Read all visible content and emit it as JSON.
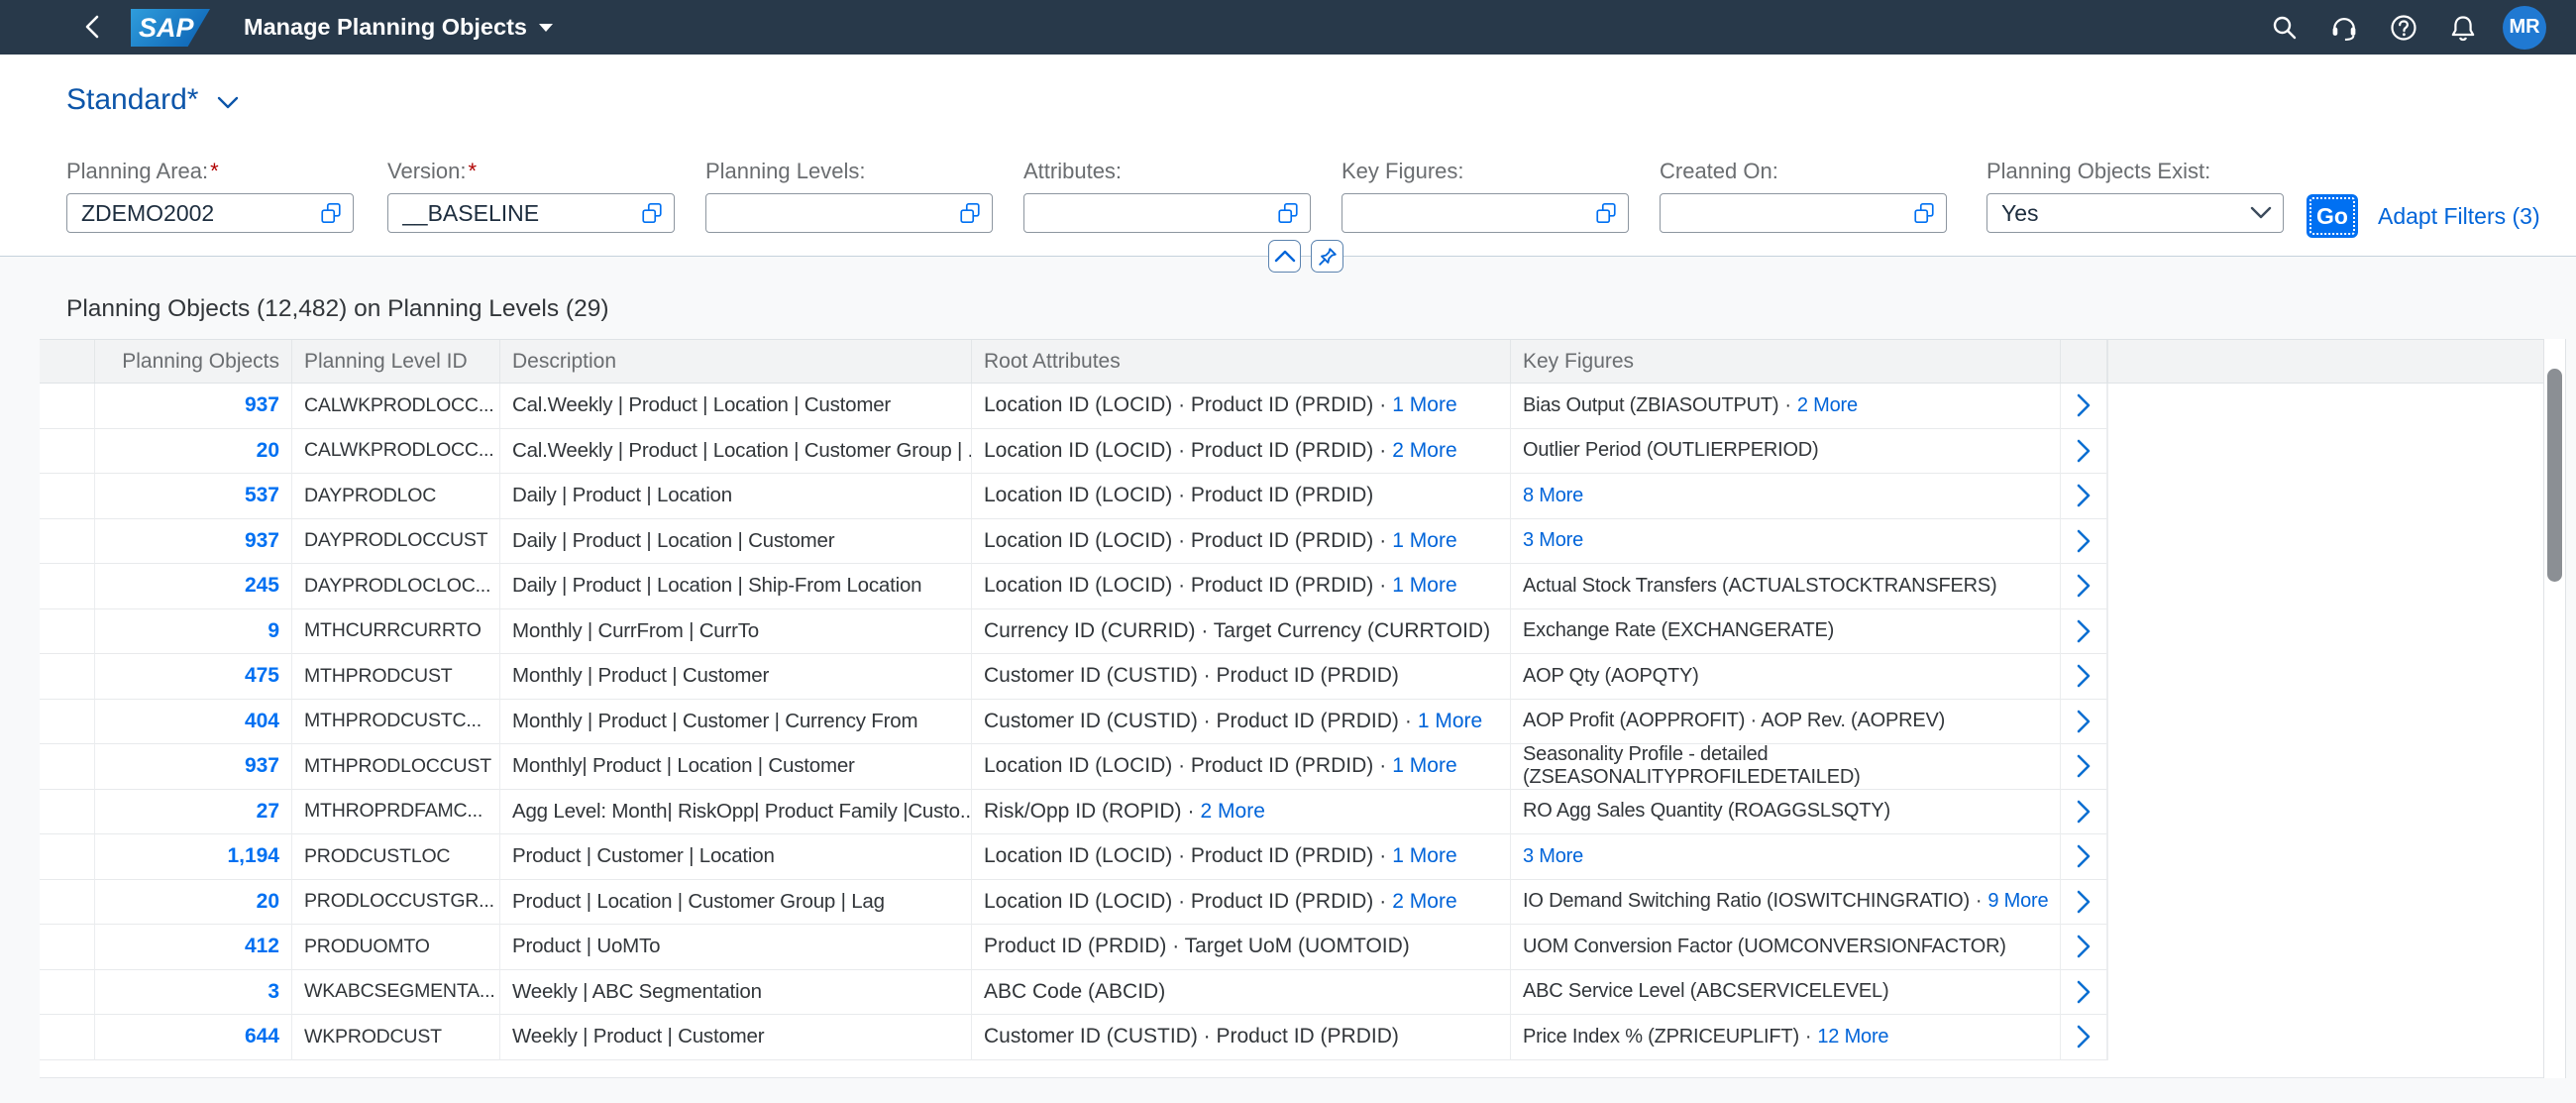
{
  "shell": {
    "title": "Manage Planning Objects",
    "logo": "SAP",
    "avatar_initials": "MR"
  },
  "variant": {
    "name": "Standard*"
  },
  "filters": {
    "fields": [
      {
        "label": "Planning Area:",
        "required": true,
        "value": "ZDEMO2002"
      },
      {
        "label": "Version:",
        "required": true,
        "value": "__BASELINE"
      },
      {
        "label": "Planning Levels:",
        "required": false,
        "value": ""
      },
      {
        "label": "Attributes:",
        "required": false,
        "value": ""
      },
      {
        "label": "Key Figures:",
        "required": false,
        "value": ""
      },
      {
        "label": "Created On:",
        "required": false,
        "value": ""
      }
    ],
    "exists": {
      "label": "Planning Objects Exist:",
      "value": "Yes"
    },
    "go_label": "Go",
    "adapt_filters_label": "Adapt Filters (3)"
  },
  "table": {
    "title": "Planning Objects (12,482) on Planning Levels (29)",
    "columns": [
      "Planning Objects",
      "Planning Level ID",
      "Description",
      "Root Attributes",
      "Key Figures"
    ],
    "rows": [
      {
        "objects": "937",
        "level_id": "CALWKPRODLOCC...",
        "description": "Cal.Weekly | Product | Location | Customer",
        "root": {
          "text": "Location ID (LOCID) · Product ID (PRDID)",
          "more": "1 More"
        },
        "kf": {
          "text": "Bias Output (ZBIASOUTPUT)",
          "more": "2 More"
        }
      },
      {
        "objects": "20",
        "level_id": "CALWKPRODLOCC...",
        "description": "Cal.Weekly | Product | Location | Customer Group | ...",
        "root": {
          "text": "Location ID (LOCID) · Product ID (PRDID)",
          "more": "2 More"
        },
        "kf": {
          "text": "Outlier Period (OUTLIERPERIOD)",
          "more": ""
        }
      },
      {
        "objects": "537",
        "level_id": "DAYPRODLOC",
        "description": "Daily | Product | Location",
        "root": {
          "text": "Location ID (LOCID) · Product ID (PRDID)",
          "more": ""
        },
        "kf": {
          "text": "",
          "more": "8 More"
        }
      },
      {
        "objects": "937",
        "level_id": "DAYPRODLOCCUST",
        "description": "Daily | Product | Location | Customer",
        "root": {
          "text": "Location ID (LOCID) · Product ID (PRDID)",
          "more": "1 More"
        },
        "kf": {
          "text": "",
          "more": "3 More"
        }
      },
      {
        "objects": "245",
        "level_id": "DAYPRODLOCLOC...",
        "description": "Daily | Product | Location | Ship-From Location",
        "root": {
          "text": "Location ID (LOCID) · Product ID (PRDID)",
          "more": "1 More"
        },
        "kf": {
          "text": "Actual Stock Transfers (ACTUALSTOCKTRANSFERS)",
          "more": ""
        }
      },
      {
        "objects": "9",
        "level_id": "MTHCURRCURRTO",
        "description": "Monthly | CurrFrom | CurrTo",
        "root": {
          "text": "Currency ID (CURRID) · Target Currency (CURRTOID)",
          "more": ""
        },
        "kf": {
          "text": "Exchange Rate (EXCHANGERATE)",
          "more": ""
        }
      },
      {
        "objects": "475",
        "level_id": "MTHPRODCUST",
        "description": "Monthly | Product | Customer",
        "root": {
          "text": "Customer ID (CUSTID) · Product ID (PRDID)",
          "more": ""
        },
        "kf": {
          "text": "AOP Qty (AOPQTY)",
          "more": ""
        }
      },
      {
        "objects": "404",
        "level_id": "MTHPRODCUSTC...",
        "description": "Monthly | Product | Customer | Currency From",
        "root": {
          "text": "Customer ID (CUSTID) · Product ID (PRDID)",
          "more": "1 More"
        },
        "kf": {
          "text": "AOP Profit (AOPPROFIT) · AOP Rev. (AOPREV)",
          "more": ""
        }
      },
      {
        "objects": "937",
        "level_id": "MTHPRODLOCCUST",
        "description": "Monthly| Product | Location | Customer",
        "root": {
          "text": "Location ID (LOCID) · Product ID (PRDID)",
          "more": "1 More"
        },
        "kf": {
          "text": "Seasonality Profile - detailed (ZSEASONALITYPROFILEDETAILED)",
          "more": ""
        }
      },
      {
        "objects": "27",
        "level_id": "MTHROPRDFAMC...",
        "description": "Agg Level: Month| RiskOpp| Product Family |Custo...",
        "root": {
          "text": "Risk/Opp ID (ROPID)",
          "more": "2 More"
        },
        "kf": {
          "text": "RO Agg Sales Quantity (ROAGGSLSQTY)",
          "more": ""
        }
      },
      {
        "objects": "1,194",
        "level_id": "PRODCUSTLOC",
        "description": "Product | Customer | Location",
        "root": {
          "text": "Location ID (LOCID) · Product ID (PRDID)",
          "more": "1 More"
        },
        "kf": {
          "text": "",
          "more": "3 More"
        }
      },
      {
        "objects": "20",
        "level_id": "PRODLOCCUSTGR...",
        "description": "Product | Location | Customer Group | Lag",
        "root": {
          "text": "Location ID (LOCID) · Product ID (PRDID)",
          "more": "2 More"
        },
        "kf": {
          "text": "IO Demand Switching Ratio (IOSWITCHINGRATIO)",
          "more": "9 More"
        }
      },
      {
        "objects": "412",
        "level_id": "PRODUOMTO",
        "description": "Product | UoMTo",
        "root": {
          "text": "Product ID (PRDID) · Target UoM (UOMTOID)",
          "more": ""
        },
        "kf": {
          "text": "UOM Conversion Factor (UOMCONVERSIONFACTOR)",
          "more": ""
        }
      },
      {
        "objects": "3",
        "level_id": "WKABCSEGMENTA...",
        "description": "Weekly | ABC Segmentation",
        "root": {
          "text": "ABC Code (ABCID)",
          "more": ""
        },
        "kf": {
          "text": "ABC Service Level (ABCSERVICELEVEL)",
          "more": ""
        }
      },
      {
        "objects": "644",
        "level_id": "WKPRODCUST",
        "description": "Weekly | Product | Customer",
        "root": {
          "text": "Customer ID (CUSTID) · Product ID (PRDID)",
          "more": ""
        },
        "kf": {
          "text": "Price Index % (ZPRICEUPLIFT)",
          "more": "12 More"
        }
      }
    ]
  }
}
